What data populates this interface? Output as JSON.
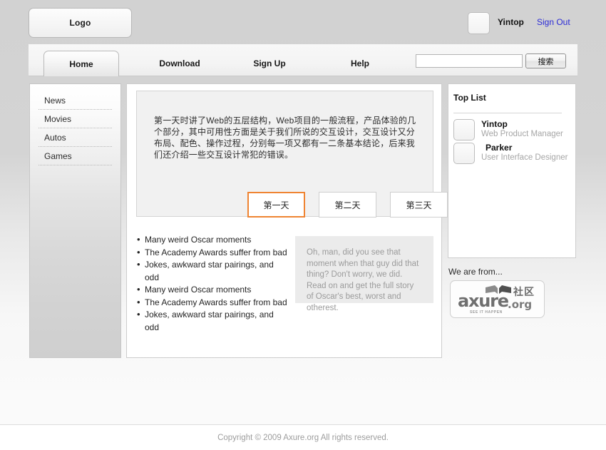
{
  "header": {
    "logo_label": "Logo",
    "user_name": "Yintop",
    "signout_label": "Sign Out"
  },
  "nav": {
    "items": [
      {
        "label": "Home",
        "active": true
      },
      {
        "label": "Download",
        "active": false
      },
      {
        "label": "Sign Up",
        "active": false
      },
      {
        "label": "Help",
        "active": false
      }
    ],
    "search": {
      "value": "",
      "placeholder": "",
      "button_label": "搜索"
    }
  },
  "sidebar": {
    "items": [
      {
        "label": "News"
      },
      {
        "label": "Movies"
      },
      {
        "label": "Autos"
      },
      {
        "label": "Games"
      }
    ]
  },
  "main": {
    "article_text": "第一天时讲了Web的五层结构，Web项目的一般流程，产品体验的几个部分，其中可用性方面是关于我们所说的交互设计，交互设计又分布局、配色、操作过程，分别每一项又都有一二条基本结论，后来我们还介绍一些交互设计常犯的错误。",
    "day_tabs": [
      {
        "label": "第一天",
        "active": true
      },
      {
        "label": "第二天",
        "active": false
      },
      {
        "label": "第三天",
        "active": false
      }
    ],
    "bullets": [
      "Many weird Oscar moments",
      "The Academy Awards suffer from bad",
      "Jokes, awkward star pairings, and odd",
      "Many weird Oscar moments",
      "The Academy Awards suffer from bad",
      "Jokes, awkward star pairings, and odd"
    ],
    "quote": "Oh, man, did you see that moment when that guy did that thing? Don't worry, we did. Read on and get the full story of Oscar's best, worst and otherest."
  },
  "top_list": {
    "title": "Top List",
    "people": [
      {
        "name": "Yintop",
        "role": "Web Product Manager"
      },
      {
        "name": "Parker",
        "role": "User Interface Designer"
      }
    ]
  },
  "sponsor": {
    "label": "We are from...",
    "logo_word": "axure",
    "logo_tld": ".org",
    "logo_cn": "社区",
    "logo_tagline": "SEE IT HAPPEN"
  },
  "footer": {
    "copyright": "Copyright © 2009 Axure.org All rights reserved."
  },
  "colors": {
    "accent": "#ef8432",
    "link": "#2b2bd6",
    "muted": "#9b9b9b"
  }
}
